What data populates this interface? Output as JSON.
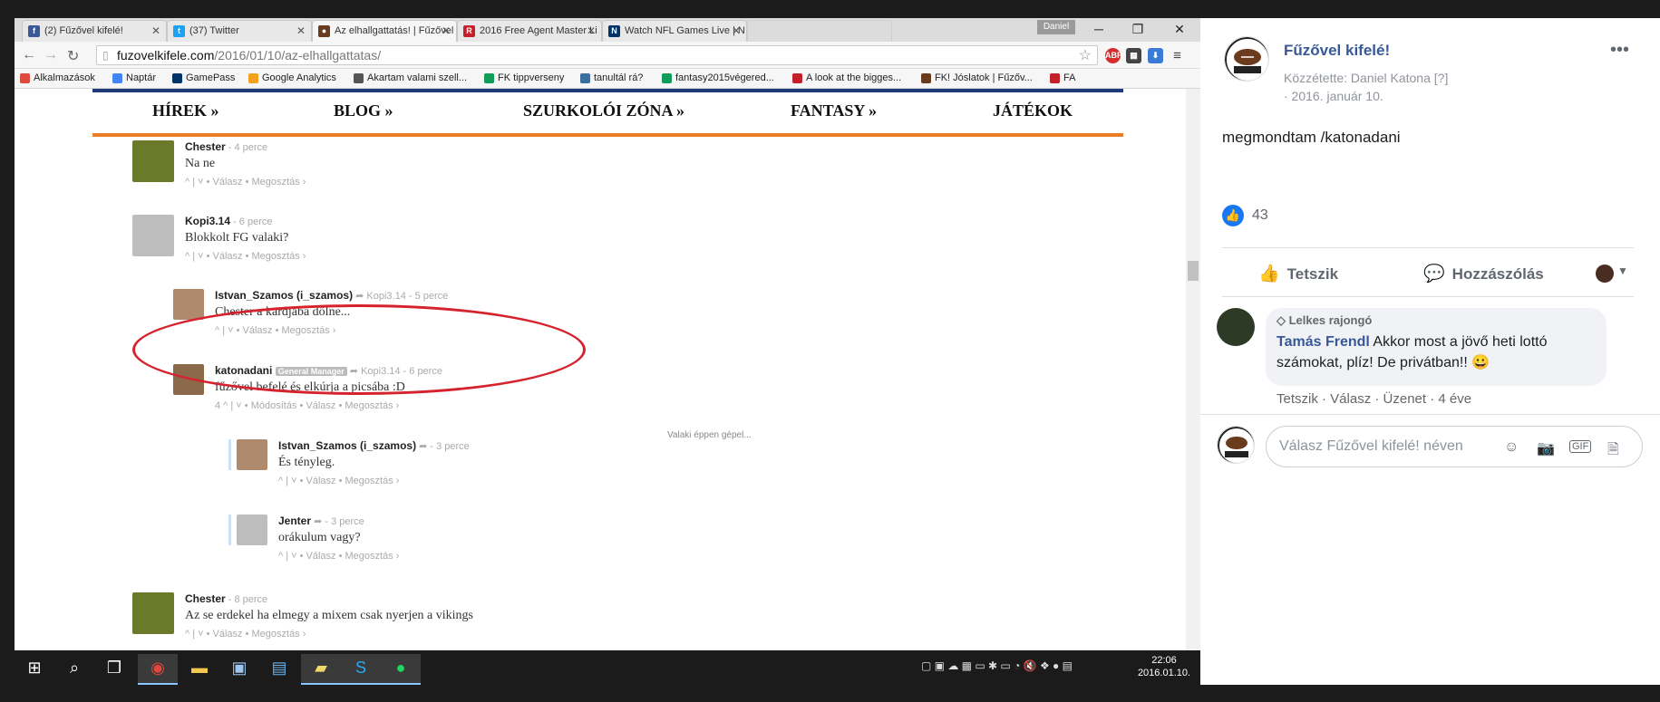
{
  "browser": {
    "tabs": [
      {
        "title": "(2) Fűzővel kifelé!",
        "icon": "facebook-icon",
        "color": "#3b5998"
      },
      {
        "title": "(37) Twitter",
        "icon": "twitter-icon",
        "color": "#1da1f2"
      },
      {
        "title": "Az elhallgattatás! | Fűzővel",
        "icon": "football-icon",
        "color": "#6b3b1e"
      },
      {
        "title": "2016 Free Agent Master Li",
        "icon": "rotoworld-icon",
        "color": "#c4202b"
      },
      {
        "title": "Watch NFL Games Live | N",
        "icon": "nfl-icon",
        "color": "#013369"
      }
    ],
    "window_user": "Daniel",
    "url_domain": "fuzovelkifele.com",
    "url_path": "/2016/01/10/az-elhallgattatas/",
    "ext_abp": "ABP",
    "bookmarks": [
      {
        "label": "Alkalmazások",
        "color": "#e04a3f"
      },
      {
        "label": "Naptár",
        "color": "#4285f4"
      },
      {
        "label": "GamePass",
        "color": "#013369"
      },
      {
        "label": "Google Analytics",
        "color": "#f4a21d"
      },
      {
        "label": "Akartam valami szell...",
        "color": "#555"
      },
      {
        "label": "FK tippverseny",
        "color": "#0f9d58"
      },
      {
        "label": "tanultál rá?",
        "color": "#3c6e9f"
      },
      {
        "label": "fantasy2015végered...",
        "color": "#0f9d58"
      },
      {
        "label": "A look at the bigges...",
        "color": "#c4202b"
      },
      {
        "label": "FK! Jóslatok | Fűzőv...",
        "color": "#6b3b1e"
      },
      {
        "label": "FA",
        "color": "#c4202b"
      }
    ]
  },
  "site": {
    "nav": [
      "HÍREK »",
      "BLOG »",
      "SZURKOLÓI ZÓNA »",
      "FANTASY »",
      "JÁTÉKOK"
    ],
    "typing": "Valaki éppen gépel...",
    "comments": [
      {
        "name": "Chester",
        "meta": " - 4 perce",
        "text": "Na ne",
        "actions": "^ | ˅ • Válasz • Megosztás ›",
        "avatar": "#6a7a2a"
      },
      {
        "name": "Kopi3.14",
        "meta": " - 6 perce",
        "text": "Blokkolt FG valaki?",
        "actions": "^ | ˅ • Válasz • Megosztás ›",
        "avatar": "#9a9a9a"
      },
      {
        "name": "Istvan_Szamos (i_szamos)",
        "meta": " ➦ Kopi3.14 - 5 perce",
        "text": "Chester a kardjába dőlne...",
        "actions": "^ | ˅ • Válasz • Megosztás ›",
        "avatar": "#b08a6c"
      },
      {
        "name": "katonadani",
        "badge": "General Manager",
        "meta": " ➦ Kopi3.14 - 6 perce",
        "text": "fűzővel befelé és elkúrja a picsába :D",
        "actions": "4 ^ | ˅ • Módosítás • Válasz • Megosztás ›",
        "avatar": "#8a6a4a"
      },
      {
        "name": "Istvan_Szamos (i_szamos)",
        "meta": " ➦ - 3 perce",
        "text": "És tényleg.",
        "actions": "^ | ˅ • Válasz • Megosztás ›",
        "avatar": "#b08a6c"
      },
      {
        "name": "Jenter",
        "meta": " ➦ - 3 perce",
        "text": "orákulum vagy?",
        "actions": "^ | ˅ • Válasz • Megosztás ›",
        "avatar": "#9a9a9a"
      },
      {
        "name": "Chester",
        "meta": " - 8 perce",
        "text": "Az se erdekel ha elmegy a mixem csak nyerjen a vikings",
        "actions": "^ | ˅ • Válasz • Megosztás ›",
        "avatar": "#6a7a2a"
      }
    ]
  },
  "taskbar": {
    "clock_time": "22:06",
    "clock_date": "2016.01.10."
  },
  "facebook": {
    "page_name": "Fűzővel kifelé!",
    "posted_by": "Közzétette: Daniel Katona [?]",
    "date": "· 2016. január 10.",
    "post_text": "megmondtam /katonadani",
    "like_count": "43",
    "like_action": "Tetszik",
    "comment_action": "Hozzászólás",
    "comment": {
      "badge": "Lelkes rajongó",
      "author": "Tamás Frendl",
      "text": " Akkor most a jövő heti lottó számokat, plíz! De privátban!! 😀",
      "actions": "Tetszik · Válasz · Üzenet · 4 éve"
    },
    "reply_placeholder": "Válasz Fűzővel kifelé! néven"
  }
}
